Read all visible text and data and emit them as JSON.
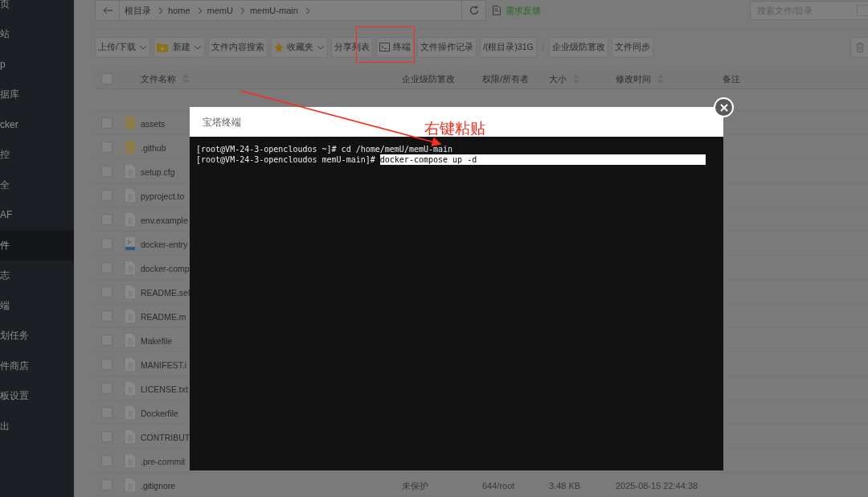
{
  "sidebar": {
    "items": [
      {
        "label": "页",
        "selected": false
      },
      {
        "label": "站",
        "selected": false
      },
      {
        "label": "p",
        "selected": false
      },
      {
        "label": "据库",
        "selected": false
      },
      {
        "label": "cker",
        "selected": false
      },
      {
        "label": "控",
        "selected": false
      },
      {
        "label": "全",
        "selected": false
      },
      {
        "label": "AF",
        "selected": false
      },
      {
        "label": "件",
        "selected": true
      },
      {
        "label": "志",
        "selected": false
      },
      {
        "label": "端",
        "selected": false
      },
      {
        "label": "划任务",
        "selected": false
      },
      {
        "label": "件商店",
        "selected": false
      },
      {
        "label": "板设置",
        "selected": false
      },
      {
        "label": "出",
        "selected": false
      }
    ]
  },
  "breadcrumb": [
    "根目录",
    "home",
    "memU",
    "memU-main"
  ],
  "feedback_link": "需求反馈",
  "search": {
    "placeholder": "搜索文件/目录",
    "checked": false
  },
  "toolbar": [
    {
      "label": "上传/下载",
      "kind": "dropdown"
    },
    {
      "label": "新建",
      "kind": "new"
    },
    {
      "label": "文件内容搜索",
      "kind": "plain"
    },
    {
      "label": "收藏夹",
      "kind": "favorites"
    },
    {
      "label": "分享列表",
      "kind": "plain"
    },
    {
      "label": "终端",
      "kind": "terminal"
    },
    {
      "label": "文件操作记录",
      "kind": "plain"
    },
    {
      "label": "/(根目录)31G",
      "kind": "plain"
    },
    {
      "label": "企业级防篡改",
      "kind": "plain"
    },
    {
      "label": "文件同步",
      "kind": "plain"
    }
  ],
  "table": {
    "all_checked": false,
    "columns": [
      {
        "label": "文件名称",
        "sortable": true
      },
      {
        "label": "企业级防篡改",
        "sortable": false
      },
      {
        "label": "权限/所有者",
        "sortable": false
      },
      {
        "label": "大小",
        "sortable": true
      },
      {
        "label": "修改时间",
        "sortable": true
      },
      {
        "label": "备注",
        "sortable": false
      }
    ],
    "rows": [
      {
        "name": "assets",
        "kind": "folder",
        "checked": false
      },
      {
        "name": ".github",
        "kind": "folder",
        "checked": false
      },
      {
        "name": "setup.cfg",
        "kind": "file",
        "checked": false
      },
      {
        "name": "pyproject.to",
        "kind": "file",
        "checked": false
      },
      {
        "name": "env.example",
        "kind": "file",
        "checked": false
      },
      {
        "name": "docker-entry",
        "kind": "script",
        "checked": false
      },
      {
        "name": "docker-comp",
        "kind": "file",
        "checked": false
      },
      {
        "name": "README.sel",
        "kind": "file",
        "checked": false
      },
      {
        "name": "README.m",
        "kind": "file",
        "checked": false
      },
      {
        "name": "Makefile",
        "kind": "file",
        "checked": false
      },
      {
        "name": "MANIFEST.i",
        "kind": "file",
        "checked": false
      },
      {
        "name": "LICENSE.txt",
        "kind": "file",
        "checked": false
      },
      {
        "name": "Dockerfile",
        "kind": "file",
        "checked": false
      },
      {
        "name": "CONTRIBUT",
        "kind": "file",
        "checked": false
      },
      {
        "name": ".pre-commit",
        "kind": "file",
        "checked": false
      },
      {
        "name": ".gitignore",
        "kind": "file",
        "checked": false,
        "protection": "未保护",
        "permission": "644/root",
        "size": "3.48 KB",
        "modified": "2025-08-15 22:44:38"
      }
    ]
  },
  "terminal": {
    "title": "宝塔终端",
    "lines": [
      {
        "prompt": "[root@VM-24-3-opencloudos ~]#",
        "command": "cd /home/memU/memU-main",
        "selected": false
      },
      {
        "prompt": "[root@VM-24-3-opencloudos memU-main]#",
        "command": "docker-compose up -d",
        "selected": true
      }
    ]
  },
  "annotation": {
    "text": "右键粘贴"
  }
}
